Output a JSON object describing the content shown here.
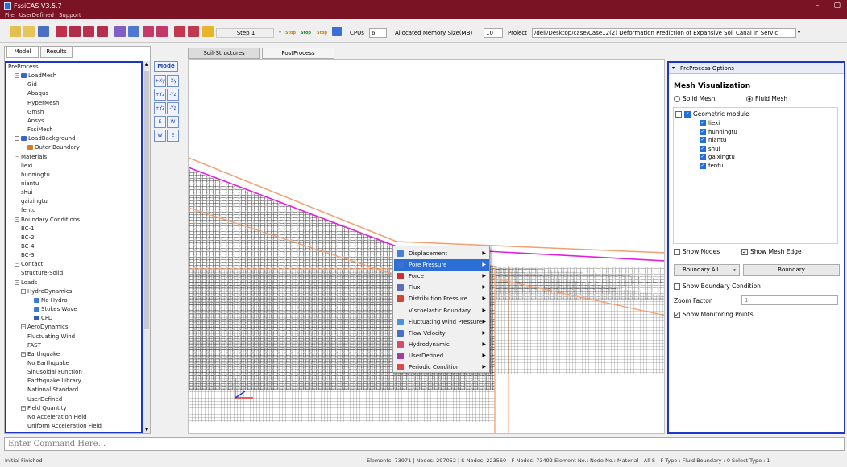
{
  "window": {
    "title": "FssiCAS V3.5.7",
    "minimize": "–",
    "maximize": "▢"
  },
  "menu": [
    "File",
    "UserDefined",
    "Support"
  ],
  "toolbar": {
    "step_value": "Step 1",
    "stop_labels": [
      "Stop",
      "Stop",
      "Stop"
    ],
    "cpus_label": "CPUs",
    "cpus_value": "6",
    "memory_label": "Allocated Memory Size(MB) :",
    "memory_value": "10",
    "project_label": "Project",
    "project_path": "/dell/Desktop/case/Case12(2) Deformation Prediction of Expansive Soil Canal in Servic"
  },
  "left_panel": {
    "tabs": [
      "Model",
      "Results"
    ],
    "tree": [
      {
        "label": "PreProcess",
        "indent": 0
      },
      {
        "label": "LoadMesh",
        "indent": 1,
        "exp": "−",
        "icon": "#3a66c7"
      },
      {
        "label": "Gid",
        "indent": 3
      },
      {
        "label": "Abaqus",
        "indent": 3
      },
      {
        "label": "HyperMesh",
        "indent": 3
      },
      {
        "label": "Gmsh",
        "indent": 3
      },
      {
        "label": "Ansys",
        "indent": 3
      },
      {
        "label": "FssiMesh",
        "indent": 3
      },
      {
        "label": "LoadBackground",
        "indent": 1,
        "exp": "−",
        "icon": "#3a66c7"
      },
      {
        "label": "Outer Boundary",
        "indent": 3,
        "icon": "#d97b1e"
      },
      {
        "label": "Materials",
        "indent": 1,
        "exp": "−"
      },
      {
        "label": "liexi",
        "indent": 2
      },
      {
        "label": "hunningtu",
        "indent": 2
      },
      {
        "label": "niantu",
        "indent": 2
      },
      {
        "label": "shui",
        "indent": 2
      },
      {
        "label": "gaixingtu",
        "indent": 2
      },
      {
        "label": "fentu",
        "indent": 2
      },
      {
        "label": "Boundary Conditions",
        "indent": 1,
        "exp": "−"
      },
      {
        "label": "BC-1",
        "indent": 2
      },
      {
        "label": "BC-2",
        "indent": 2
      },
      {
        "label": "BC-4",
        "indent": 2
      },
      {
        "label": "BC-3",
        "indent": 2
      },
      {
        "label": "Contact",
        "indent": 1,
        "exp": "−"
      },
      {
        "label": "Structure-Solid",
        "indent": 2
      },
      {
        "label": "Loads",
        "indent": 1,
        "exp": "−"
      },
      {
        "label": "HydroDynamics",
        "indent": 2,
        "exp": "−"
      },
      {
        "label": "No Hydro",
        "indent": 4,
        "icon": "#3a7bd5"
      },
      {
        "label": "Stokes Wave",
        "indent": 4,
        "icon": "#3a7bd5"
      },
      {
        "label": "CFD",
        "indent": 4,
        "icon": "#2e5fb3"
      },
      {
        "label": "AeroDynamics",
        "indent": 2,
        "exp": "−"
      },
      {
        "label": "Fluctuating Wind",
        "indent": 3
      },
      {
        "label": "FAST",
        "indent": 3
      },
      {
        "label": "Earthquake",
        "indent": 2,
        "exp": "−"
      },
      {
        "label": "No Earthquake",
        "indent": 3
      },
      {
        "label": "Sinusoidal Function",
        "indent": 3
      },
      {
        "label": "Earthquake Library",
        "indent": 3
      },
      {
        "label": "National Standard",
        "indent": 3
      },
      {
        "label": "UserDefined",
        "indent": 3
      },
      {
        "label": "Field Quantity",
        "indent": 2,
        "exp": "−"
      },
      {
        "label": "No Acceleration Field",
        "indent": 3
      },
      {
        "label": "Uniform Acceleration Field",
        "indent": 3
      }
    ]
  },
  "vtoolbar": {
    "mode_label": "Mode",
    "buttons": [
      "+Xy",
      "-Xy",
      "+Yz",
      "-Yz",
      "+Yz",
      "-Yz",
      "E",
      "W",
      "W",
      "E"
    ]
  },
  "center_tabs": [
    "Soil-Structures",
    "PostProcess"
  ],
  "logo": {
    "text": "Fssi"
  },
  "context_menu": [
    {
      "label": "Displacement",
      "icon": "#4a7fd8"
    },
    {
      "label": "Pore Pressure",
      "icon": "#3f6fd0",
      "highlight": true
    },
    {
      "label": "Force",
      "icon": "#c93030"
    },
    {
      "label": "Flux",
      "icon": "#5b6fb5"
    },
    {
      "label": "Distribution Pressure",
      "icon": "#d6452d"
    },
    {
      "label": "Viscoelastic Boundary",
      "icon": ""
    },
    {
      "label": "Fluctuating Wind Pressure",
      "icon": "#4b92e0"
    },
    {
      "label": "Flow Velocity",
      "icon": "#4b6ec5"
    },
    {
      "label": "Hydrodynamic",
      "icon": "#d34b6e"
    },
    {
      "label": "UserDefined",
      "icon": "#a43aa8"
    },
    {
      "label": "Periodic Condition",
      "icon": "#e04848"
    }
  ],
  "right_panel": {
    "header": "PreProcess Options",
    "section_title": "Mesh Visualization",
    "solid_mesh": "Solid Mesh",
    "fluid_mesh": "Fluid Mesh",
    "geometric_module": "Geometric module",
    "modules": [
      "liexi",
      "hunningtu",
      "niantu",
      "shui",
      "gaixingtu",
      "fentu"
    ],
    "show_nodes": "Show Nodes",
    "show_mesh_edge": "Show Mesh Edge",
    "boundary_select": "Boundary All",
    "boundary_button": "Boundary",
    "show_boundary_condition": "Show Boundary Condition",
    "zoom_factor_label": "Zoom Factor",
    "zoom_factor_value": "1",
    "show_monitoring_points": "Show Monitoring Points"
  },
  "command_placeholder": "Enter Command Here...",
  "status": {
    "left": "Initial Finished",
    "right": "Elements: 73971 | Nodes: 297052 | S-Nodes: 223560 | F-Nodes: 73492 Element No.:  Node No.:  Material : All  S - F Type : Fluid  Boundary : 0  Select Type : 1"
  }
}
